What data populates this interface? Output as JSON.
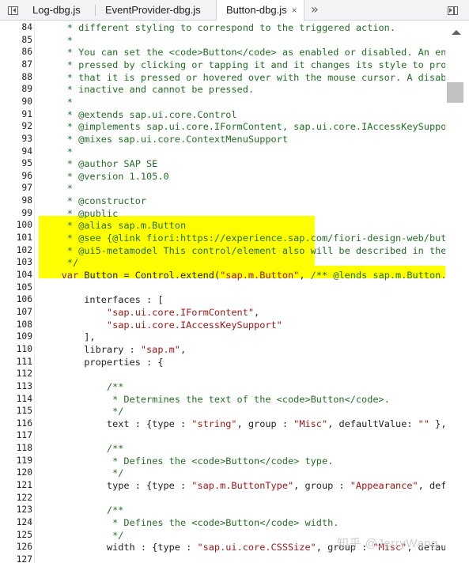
{
  "tabs": [
    {
      "label": "Log-dbg.js",
      "active": false
    },
    {
      "label": "EventProvider-dbg.js",
      "active": false
    },
    {
      "label": "Button-dbg.js",
      "active": true,
      "close": "×"
    }
  ],
  "overflow": "»",
  "watermark": "知乎 @JerryWang",
  "code_lines": [
    {
      "n": "84",
      "t": "     * different styling to correspond to the triggered action.",
      "k": "c"
    },
    {
      "n": "85",
      "t": "     *",
      "k": "c"
    },
    {
      "n": "86",
      "t": "     * You can set the <code>Button</code> as enabled or disabled. An enabled",
      "k": "c"
    },
    {
      "n": "87",
      "t": "     * pressed by clicking or tapping it and it changes its style to provide",
      "k": "c"
    },
    {
      "n": "88",
      "t": "     * that it is pressed or hovered over with the mouse cursor. A disabled",
      "k": "c"
    },
    {
      "n": "89",
      "t": "     * inactive and cannot be pressed.",
      "k": "c"
    },
    {
      "n": "90",
      "t": "     *",
      "k": "c"
    },
    {
      "n": "91",
      "t": "     * @extends sap.ui.core.Control",
      "k": "c"
    },
    {
      "n": "92",
      "t": "     * @implements sap.ui.core.IFormContent, sap.ui.core.IAccessKeySupport",
      "k": "c"
    },
    {
      "n": "93",
      "t": "     * @mixes sap.ui.core.ContextMenuSupport",
      "k": "c"
    },
    {
      "n": "94",
      "t": "     *",
      "k": "c"
    },
    {
      "n": "95",
      "t": "     * @author SAP SE",
      "k": "c"
    },
    {
      "n": "96",
      "t": "     * @version 1.105.0",
      "k": "c"
    },
    {
      "n": "97",
      "t": "     *",
      "k": "c"
    },
    {
      "n": "98",
      "t": "     * @constructor",
      "k": "c"
    },
    {
      "n": "99",
      "t": "     * @public",
      "k": "c"
    },
    {
      "n": "100",
      "t": "     * @alias sap.m.Button",
      "k": "c"
    },
    {
      "n": "101",
      "t": "     * @see {@link fiori:https://experience.sap.com/fiori-design-web/button/",
      "k": "c"
    },
    {
      "n": "102",
      "t": "     * @ui5-metamodel This control/element also will be described in the",
      "k": "c"
    },
    {
      "n": "103",
      "t": "     */",
      "k": "c"
    },
    {
      "n": "104",
      "parts": [
        [
          "    ",
          "p"
        ],
        [
          "var",
          "k"
        ],
        [
          " Button = Control.extend(",
          "p"
        ],
        [
          "\"sap.m.Button\"",
          "s"
        ],
        [
          ", ",
          "p"
        ],
        [
          "/** @lends sap.m.Button.prototype */",
          "c"
        ]
      ]
    },
    {
      "n": "105",
      "t": "",
      "k": "p"
    },
    {
      "n": "106",
      "t": "        interfaces : [",
      "k": "p"
    },
    {
      "n": "107",
      "parts": [
        [
          "            ",
          "p"
        ],
        [
          "\"sap.ui.core.IFormContent\"",
          "s"
        ],
        [
          ",",
          "p"
        ]
      ]
    },
    {
      "n": "108",
      "parts": [
        [
          "            ",
          "p"
        ],
        [
          "\"sap.ui.core.IAccessKeySupport\"",
          "s"
        ]
      ]
    },
    {
      "n": "109",
      "t": "        ],",
      "k": "p"
    },
    {
      "n": "110",
      "parts": [
        [
          "        library : ",
          "p"
        ],
        [
          "\"sap.m\"",
          "s"
        ],
        [
          ",",
          "p"
        ]
      ]
    },
    {
      "n": "111",
      "t": "        properties : {",
      "k": "p"
    },
    {
      "n": "112",
      "t": "",
      "k": "p"
    },
    {
      "n": "113",
      "t": "            /**",
      "k": "c"
    },
    {
      "n": "114",
      "t": "             * Determines the text of the <code>Button</code>.",
      "k": "c"
    },
    {
      "n": "115",
      "t": "             */",
      "k": "c"
    },
    {
      "n": "116",
      "parts": [
        [
          "            text : {type : ",
          "p"
        ],
        [
          "\"string\"",
          "s"
        ],
        [
          ", group : ",
          "p"
        ],
        [
          "\"Misc\"",
          "s"
        ],
        [
          ", defaultValue: ",
          "p"
        ],
        [
          "\"\"",
          "s"
        ],
        [
          " },",
          "p"
        ]
      ]
    },
    {
      "n": "117",
      "t": "",
      "k": "p"
    },
    {
      "n": "118",
      "t": "            /**",
      "k": "c"
    },
    {
      "n": "119",
      "t": "             * Defines the <code>Button</code> type.",
      "k": "c"
    },
    {
      "n": "120",
      "t": "             */",
      "k": "c"
    },
    {
      "n": "121",
      "parts": [
        [
          "            type : {type : ",
          "p"
        ],
        [
          "\"sap.m.ButtonType\"",
          "s"
        ],
        [
          ", group : ",
          "p"
        ],
        [
          "\"Appearance\"",
          "s"
        ],
        [
          ", defaultValue",
          "p"
        ]
      ]
    },
    {
      "n": "122",
      "t": "",
      "k": "p"
    },
    {
      "n": "123",
      "t": "            /**",
      "k": "c"
    },
    {
      "n": "124",
      "t": "             * Defines the <code>Button</code> width.",
      "k": "c"
    },
    {
      "n": "125",
      "t": "             */",
      "k": "c"
    },
    {
      "n": "126",
      "parts": [
        [
          "            width : {type : ",
          "p"
        ],
        [
          "\"sap.ui.core.CSSSize\"",
          "s"
        ],
        [
          ", group : ",
          "p"
        ],
        [
          "\"Misc\"",
          "s"
        ],
        [
          ", defaultValue",
          "p"
        ]
      ]
    },
    {
      "n": "127",
      "t": "",
      "k": "p"
    }
  ]
}
